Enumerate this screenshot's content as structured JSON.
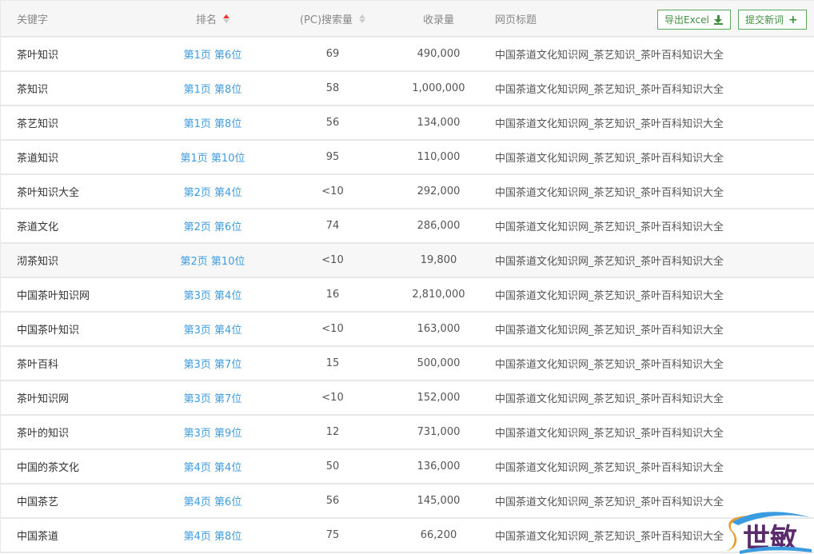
{
  "header": {
    "keyword": "关键字",
    "rank": "排名",
    "pc_search": "(PC)搜索量",
    "indexed": "收录量",
    "page_title": "网页标题",
    "export_label": "导出Excel",
    "submit_label": "提交新词"
  },
  "sort": {
    "rank": "ascending",
    "pc_search": "none"
  },
  "colors": {
    "link": "#3e9be0",
    "accent_green": "#3e8f3e",
    "sort_active": "#e33333"
  },
  "rows": [
    {
      "keyword": "茶叶知识",
      "rank": "第1页 第6位",
      "pc": "69",
      "indexed": "490,000",
      "title": "中国茶道文化知识网_茶艺知识_茶叶百科知识大全"
    },
    {
      "keyword": "茶知识",
      "rank": "第1页 第8位",
      "pc": "58",
      "indexed": "1,000,000",
      "title": "中国茶道文化知识网_茶艺知识_茶叶百科知识大全"
    },
    {
      "keyword": "茶艺知识",
      "rank": "第1页 第8位",
      "pc": "56",
      "indexed": "134,000",
      "title": "中国茶道文化知识网_茶艺知识_茶叶百科知识大全"
    },
    {
      "keyword": "茶道知识",
      "rank": "第1页 第10位",
      "pc": "95",
      "indexed": "110,000",
      "title": "中国茶道文化知识网_茶艺知识_茶叶百科知识大全"
    },
    {
      "keyword": "茶叶知识大全",
      "rank": "第2页 第4位",
      "pc": "<10",
      "indexed": "292,000",
      "title": "中国茶道文化知识网_茶艺知识_茶叶百科知识大全"
    },
    {
      "keyword": "茶道文化",
      "rank": "第2页 第6位",
      "pc": "74",
      "indexed": "286,000",
      "title": "中国茶道文化知识网_茶艺知识_茶叶百科知识大全"
    },
    {
      "keyword": "沏茶知识",
      "rank": "第2页 第10位",
      "pc": "<10",
      "indexed": "19,800",
      "title": "中国茶道文化知识网_茶艺知识_茶叶百科知识大全",
      "highlighted": true
    },
    {
      "keyword": "中国茶叶知识网",
      "rank": "第3页 第4位",
      "pc": "16",
      "indexed": "2,810,000",
      "title": "中国茶道文化知识网_茶艺知识_茶叶百科知识大全"
    },
    {
      "keyword": "中国茶叶知识",
      "rank": "第3页 第4位",
      "pc": "<10",
      "indexed": "163,000",
      "title": "中国茶道文化知识网_茶艺知识_茶叶百科知识大全"
    },
    {
      "keyword": "茶叶百科",
      "rank": "第3页 第7位",
      "pc": "15",
      "indexed": "500,000",
      "title": "中国茶道文化知识网_茶艺知识_茶叶百科知识大全"
    },
    {
      "keyword": "茶叶知识网",
      "rank": "第3页 第7位",
      "pc": "<10",
      "indexed": "152,000",
      "title": "中国茶道文化知识网_茶艺知识_茶叶百科知识大全"
    },
    {
      "keyword": "茶叶的知识",
      "rank": "第3页 第9位",
      "pc": "12",
      "indexed": "731,000",
      "title": "中国茶道文化知识网_茶艺知识_茶叶百科知识大全"
    },
    {
      "keyword": "中国的茶文化",
      "rank": "第4页 第4位",
      "pc": "50",
      "indexed": "136,000",
      "title": "中国茶道文化知识网_茶艺知识_茶叶百科知识大全"
    },
    {
      "keyword": "中国茶艺",
      "rank": "第4页 第6位",
      "pc": "56",
      "indexed": "145,000",
      "title": "中国茶道文化知识网_茶艺知识_茶叶百科知识大全"
    },
    {
      "keyword": "中国茶道",
      "rank": "第4页 第8位",
      "pc": "75",
      "indexed": "66,200",
      "title": "中国茶道文化知识网_茶艺知识_茶叶百科知识大全"
    }
  ],
  "watermark": {
    "text": "世敏"
  }
}
